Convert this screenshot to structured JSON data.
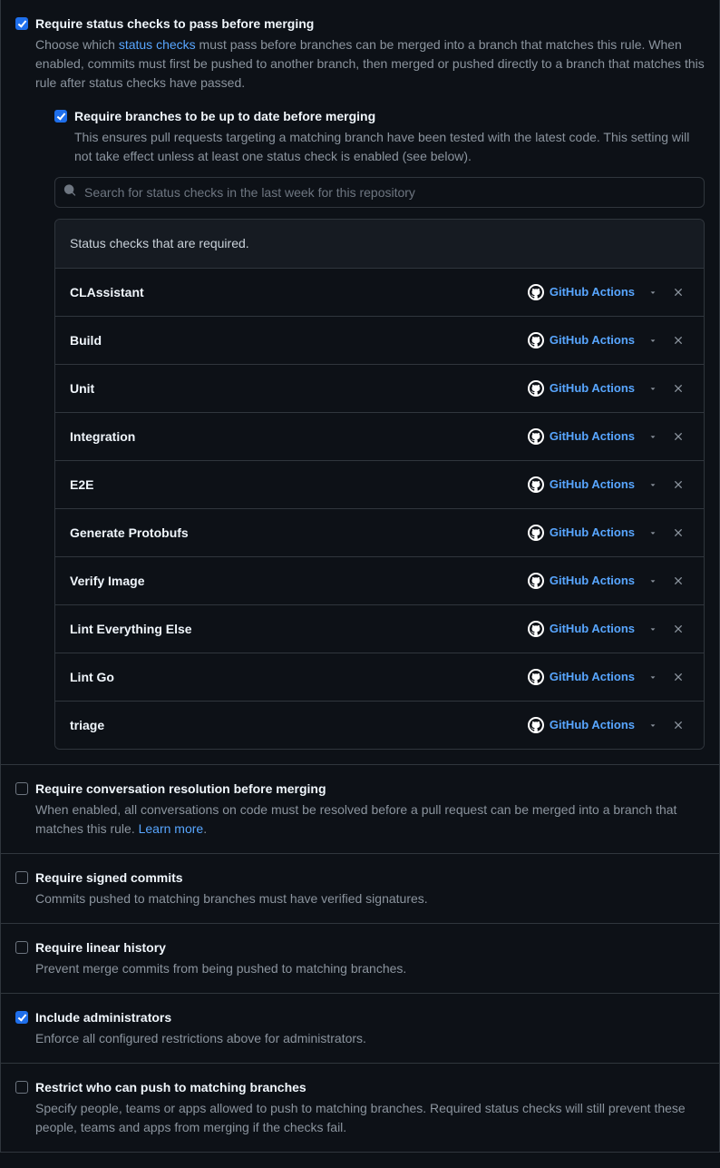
{
  "rules": {
    "status_checks": {
      "checked": true,
      "title": "Require status checks to pass before merging",
      "desc_pre": "Choose which ",
      "link": "status checks",
      "desc_post": " must pass before branches can be merged into a branch that matches this rule. When enabled, commits must first be pushed to another branch, then merged or pushed directly to a branch that matches this rule after status checks have passed.",
      "up_to_date": {
        "checked": true,
        "title": "Require branches to be up to date before merging",
        "desc": "This ensures pull requests targeting a matching branch have been tested with the latest code. This setting will not take effect unless at least one status check is enabled (see below)."
      },
      "search_placeholder": "Search for status checks in the last week for this repository",
      "checks_header": "Status checks that are required.",
      "source_label": "GitHub Actions",
      "checks": [
        {
          "name": "CLAssistant"
        },
        {
          "name": "Build"
        },
        {
          "name": "Unit"
        },
        {
          "name": "Integration"
        },
        {
          "name": "E2E"
        },
        {
          "name": "Generate Protobufs"
        },
        {
          "name": "Verify Image"
        },
        {
          "name": "Lint Everything Else"
        },
        {
          "name": "Lint Go"
        },
        {
          "name": "triage"
        }
      ]
    },
    "conversation": {
      "checked": false,
      "title": "Require conversation resolution before merging",
      "desc": "When enabled, all conversations on code must be resolved before a pull request can be merged into a branch that matches this rule. ",
      "link": "Learn more",
      "period": "."
    },
    "signed": {
      "checked": false,
      "title": "Require signed commits",
      "desc": "Commits pushed to matching branches must have verified signatures."
    },
    "linear": {
      "checked": false,
      "title": "Require linear history",
      "desc": "Prevent merge commits from being pushed to matching branches."
    },
    "admins": {
      "checked": true,
      "title": "Include administrators",
      "desc": "Enforce all configured restrictions above for administrators."
    },
    "restrict": {
      "checked": false,
      "title": "Restrict who can push to matching branches",
      "desc": "Specify people, teams or apps allowed to push to matching branches. Required status checks will still prevent these people, teams and apps from merging if the checks fail."
    }
  }
}
